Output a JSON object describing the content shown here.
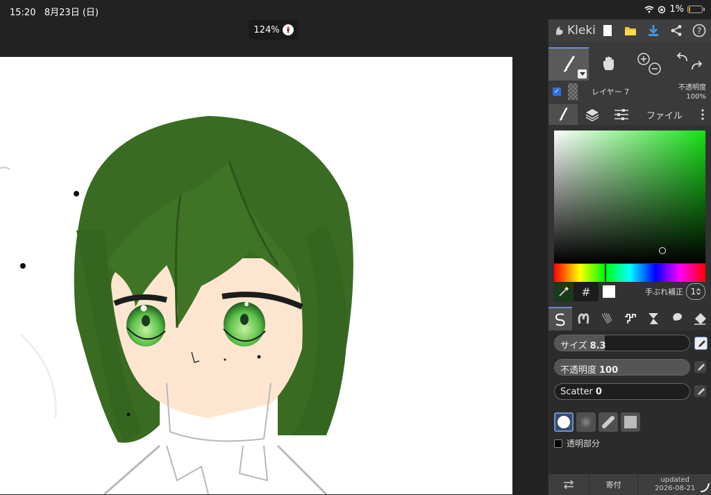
{
  "status_bar": {
    "time": "15:20",
    "date": "8月23日 (日)",
    "battery": "1%"
  },
  "canvas": {
    "zoom": "124%"
  },
  "app": {
    "logo_text": "Kleki"
  },
  "layer": {
    "name": "レイヤー 7",
    "opacity_label": "不透明度",
    "opacity_value": "100%",
    "visible": true
  },
  "tabs": {
    "file_label": "ファイル"
  },
  "color": {
    "selected_hex": "#1b8a1b",
    "hash_symbol": "#",
    "stabilizer_label": "手ぶれ補正",
    "stabilizer_value": "1"
  },
  "brush": {
    "size_label": "サイズ",
    "size_value": "8.3",
    "opacity_label": "不透明度",
    "opacity_value": "100",
    "scatter_label": "Scatter",
    "scatter_value": "0",
    "size_fraction": 0.37,
    "opacity_fraction": 1.0,
    "scatter_fraction": 0.0,
    "lock_alpha_label": "透明部分"
  },
  "bottom_bar": {
    "donate_label": "寄付",
    "updated_label": "updated",
    "updated_date": "2026-08-21"
  }
}
